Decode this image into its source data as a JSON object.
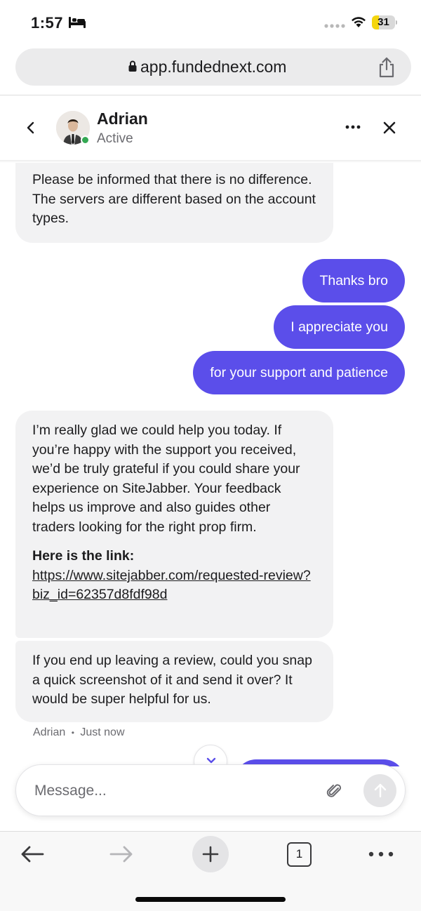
{
  "status_bar": {
    "time": "1:57",
    "battery_level": "31",
    "battery_fraction": 0.31
  },
  "browser": {
    "url": "app.fundednext.com",
    "open_tabs": "1"
  },
  "chat_header": {
    "agent_name": "Adrian",
    "agent_status": "Active"
  },
  "messages": {
    "incoming_1": "Please be informed that there is no difference. The servers are different based on the account types.",
    "outgoing": [
      "Thanks bro",
      "I appreciate you",
      "for your support and patience"
    ],
    "incoming_2": {
      "paragraph": "I’m really glad we could help you today. If you’re happy with the support you received, we’d be truly grateful if you could share your experience on SiteJabber. Your feedback helps us improve and also guides other traders looking for the right prop firm.",
      "link_heading": "Here is the link:",
      "link": "https://www.sitejabber.com/requested-review?biz_id=62357d8fdf98d"
    },
    "incoming_3": "If you end up leaving a review, could you snap a quick screenshot of it and send it over? It would be super helpful for us.",
    "meta_sender": "Adrian",
    "meta_time": "Just now",
    "meta_separator": "•"
  },
  "composer": {
    "placeholder": "Message...",
    "value": ""
  },
  "colors": {
    "accent": "#5b4eea",
    "incoming_bubble": "#f2f2f3",
    "online": "#34a853",
    "battery": "#f5d60e"
  },
  "icons": [
    "bed-icon",
    "signal-dots-icon",
    "wifi-icon",
    "battery-icon",
    "lock-icon",
    "share-icon",
    "chevron-left-icon",
    "more-icon",
    "close-icon",
    "chevron-down-icon",
    "paperclip-icon",
    "arrow-up-icon",
    "arrow-left-icon",
    "arrow-right-icon",
    "plus-icon",
    "tabs-icon",
    "ellipsis-icon"
  ]
}
